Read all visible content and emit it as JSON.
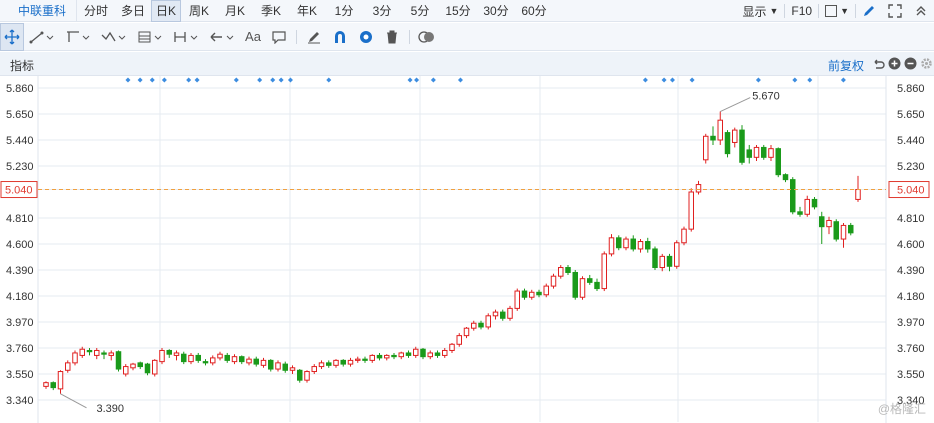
{
  "stock_name": "中联重科",
  "periods": [
    "分时",
    "多日",
    "日K",
    "周K",
    "月K",
    "季K",
    "年K",
    "1分",
    "3分",
    "5分",
    "15分",
    "30分",
    "60分"
  ],
  "active_period": "日K",
  "top_right": {
    "display_label": "显示",
    "f10_label": "F10"
  },
  "tools": [
    "move-icon",
    "line-icon",
    "channel-icon",
    "wave-icon",
    "fib-icon",
    "range-icon",
    "arrow-icon",
    "text-icon",
    "comment-icon",
    "eraser-icon",
    "magnet-icon",
    "eye-icon",
    "trash-icon",
    "toggle-icon"
  ],
  "text_tool_label": "Aa",
  "indicator_label": "指标",
  "adjust_label": "前复权",
  "y_axis_left": [
    "5.860",
    "5.650",
    "5.440",
    "5.230",
    "5.040",
    "4.810",
    "4.600",
    "4.390",
    "4.180",
    "3.970",
    "3.760",
    "3.550",
    "3.340"
  ],
  "y_axis_right": [
    "5.860",
    "5.650",
    "5.440",
    "5.230",
    "5.040",
    "4.810",
    "4.600",
    "4.390",
    "4.180",
    "3.970",
    "3.760",
    "3.550",
    "3.340"
  ],
  "current_price": "5.040",
  "high_label": "5.670",
  "low_label": "3.390",
  "watermark": "@格隆汇",
  "colors": {
    "up": "#e02020",
    "down": "#1a9a1a",
    "grid": "#e6ebf1",
    "accent": "#1a6fc9",
    "price_line": "#f0a040"
  },
  "chart_data": {
    "type": "candlestick",
    "ylim": [
      3.25,
      5.95
    ],
    "candles": [
      [
        3.45,
        3.48,
        3.43,
        3.49
      ],
      [
        3.48,
        3.44,
        3.42,
        3.49
      ],
      [
        3.43,
        3.57,
        3.39,
        3.58
      ],
      [
        3.58,
        3.64,
        3.56,
        3.66
      ],
      [
        3.64,
        3.72,
        3.62,
        3.74
      ],
      [
        3.7,
        3.75,
        3.68,
        3.77
      ],
      [
        3.74,
        3.73,
        3.7,
        3.76
      ],
      [
        3.7,
        3.74,
        3.67,
        3.76
      ],
      [
        3.72,
        3.71,
        3.67,
        3.74
      ],
      [
        3.7,
        3.72,
        3.66,
        3.74
      ],
      [
        3.73,
        3.59,
        3.57,
        3.74
      ],
      [
        3.55,
        3.61,
        3.53,
        3.63
      ],
      [
        3.6,
        3.63,
        3.58,
        3.64
      ],
      [
        3.64,
        3.61,
        3.59,
        3.65
      ],
      [
        3.63,
        3.56,
        3.54,
        3.64
      ],
      [
        3.55,
        3.66,
        3.53,
        3.67
      ],
      [
        3.65,
        3.74,
        3.63,
        3.76
      ],
      [
        3.74,
        3.71,
        3.68,
        3.75
      ],
      [
        3.7,
        3.72,
        3.66,
        3.74
      ],
      [
        3.71,
        3.65,
        3.63,
        3.73
      ],
      [
        3.65,
        3.7,
        3.63,
        3.72
      ],
      [
        3.7,
        3.66,
        3.64,
        3.72
      ],
      [
        3.65,
        3.64,
        3.62,
        3.67
      ],
      [
        3.64,
        3.68,
        3.62,
        3.7
      ],
      [
        3.68,
        3.71,
        3.66,
        3.73
      ],
      [
        3.7,
        3.66,
        3.64,
        3.72
      ],
      [
        3.65,
        3.69,
        3.63,
        3.71
      ],
      [
        3.69,
        3.65,
        3.63,
        3.7
      ],
      [
        3.64,
        3.67,
        3.62,
        3.69
      ],
      [
        3.67,
        3.63,
        3.61,
        3.69
      ],
      [
        3.62,
        3.66,
        3.6,
        3.68
      ],
      [
        3.66,
        3.59,
        3.57,
        3.67
      ],
      [
        3.59,
        3.64,
        3.57,
        3.66
      ],
      [
        3.63,
        3.58,
        3.56,
        3.65
      ],
      [
        3.58,
        3.6,
        3.55,
        3.62
      ],
      [
        3.58,
        3.5,
        3.48,
        3.59
      ],
      [
        3.5,
        3.57,
        3.48,
        3.58
      ],
      [
        3.57,
        3.61,
        3.55,
        3.63
      ],
      [
        3.61,
        3.64,
        3.59,
        3.66
      ],
      [
        3.64,
        3.62,
        3.6,
        3.66
      ],
      [
        3.62,
        3.66,
        3.6,
        3.67
      ],
      [
        3.66,
        3.63,
        3.61,
        3.67
      ],
      [
        3.63,
        3.66,
        3.61,
        3.68
      ],
      [
        3.66,
        3.67,
        3.64,
        3.69
      ],
      [
        3.67,
        3.66,
        3.64,
        3.69
      ],
      [
        3.66,
        3.7,
        3.64,
        3.71
      ],
      [
        3.7,
        3.68,
        3.66,
        3.72
      ],
      [
        3.68,
        3.7,
        3.66,
        3.71
      ],
      [
        3.7,
        3.69,
        3.67,
        3.72
      ],
      [
        3.69,
        3.72,
        3.67,
        3.73
      ],
      [
        3.72,
        3.7,
        3.68,
        3.74
      ],
      [
        3.7,
        3.75,
        3.68,
        3.77
      ],
      [
        3.75,
        3.69,
        3.67,
        3.76
      ],
      [
        3.69,
        3.72,
        3.67,
        3.74
      ],
      [
        3.72,
        3.7,
        3.68,
        3.74
      ],
      [
        3.7,
        3.74,
        3.68,
        3.76
      ],
      [
        3.74,
        3.79,
        3.72,
        3.8
      ],
      [
        3.79,
        3.86,
        3.77,
        3.88
      ],
      [
        3.86,
        3.92,
        3.84,
        3.93
      ],
      [
        3.92,
        3.96,
        3.9,
        3.98
      ],
      [
        3.96,
        3.93,
        3.91,
        3.98
      ],
      [
        3.93,
        4.02,
        3.91,
        4.04
      ],
      [
        4.02,
        4.05,
        3.99,
        4.07
      ],
      [
        4.05,
        4.0,
        3.98,
        4.07
      ],
      [
        4.0,
        4.08,
        3.98,
        4.1
      ],
      [
        4.08,
        4.22,
        4.06,
        4.24
      ],
      [
        4.22,
        4.17,
        4.15,
        4.24
      ],
      [
        4.17,
        4.21,
        4.15,
        4.23
      ],
      [
        4.21,
        4.19,
        4.17,
        4.23
      ],
      [
        4.19,
        4.26,
        4.17,
        4.28
      ],
      [
        4.26,
        4.34,
        4.24,
        4.36
      ],
      [
        4.34,
        4.41,
        4.32,
        4.43
      ],
      [
        4.41,
        4.37,
        4.35,
        4.43
      ],
      [
        4.37,
        4.17,
        4.15,
        4.39
      ],
      [
        4.17,
        4.32,
        4.15,
        4.34
      ],
      [
        4.32,
        4.29,
        4.27,
        4.35
      ],
      [
        4.29,
        4.24,
        4.22,
        4.32
      ],
      [
        4.24,
        4.52,
        4.22,
        4.54
      ],
      [
        4.52,
        4.65,
        4.5,
        4.68
      ],
      [
        4.65,
        4.57,
        4.55,
        4.67
      ],
      [
        4.57,
        4.64,
        4.55,
        4.66
      ],
      [
        4.64,
        4.56,
        4.54,
        4.67
      ],
      [
        4.56,
        4.62,
        4.53,
        4.64
      ],
      [
        4.62,
        4.56,
        4.53,
        4.65
      ],
      [
        4.56,
        4.41,
        4.39,
        4.58
      ],
      [
        4.41,
        4.5,
        4.38,
        4.52
      ],
      [
        4.5,
        4.42,
        4.38,
        4.52
      ],
      [
        4.42,
        4.61,
        4.4,
        4.63
      ],
      [
        4.61,
        4.72,
        4.59,
        4.74
      ],
      [
        4.72,
        5.02,
        4.7,
        5.05
      ],
      [
        5.02,
        5.08,
        5.0,
        5.11
      ],
      [
        5.28,
        5.47,
        5.25,
        5.49
      ],
      [
        5.47,
        5.44,
        5.4,
        5.55
      ],
      [
        5.44,
        5.6,
        5.4,
        5.67
      ],
      [
        5.5,
        5.33,
        5.3,
        5.52
      ],
      [
        5.42,
        5.52,
        5.38,
        5.54
      ],
      [
        5.52,
        5.26,
        5.24,
        5.56
      ],
      [
        5.36,
        5.3,
        5.25,
        5.4
      ],
      [
        5.3,
        5.38,
        5.27,
        5.4
      ],
      [
        5.38,
        5.3,
        5.28,
        5.4
      ],
      [
        5.3,
        5.37,
        5.27,
        5.4
      ],
      [
        5.37,
        5.16,
        5.14,
        5.38
      ],
      [
        5.16,
        5.12,
        5.1,
        5.17
      ],
      [
        5.12,
        4.86,
        4.84,
        5.14
      ],
      [
        4.86,
        4.84,
        4.82,
        4.9
      ],
      [
        4.84,
        4.96,
        4.82,
        4.99
      ],
      [
        4.96,
        4.9,
        4.88,
        4.98
      ],
      [
        4.82,
        4.74,
        4.6,
        4.86
      ],
      [
        4.74,
        4.79,
        4.68,
        4.82
      ],
      [
        4.78,
        4.64,
        4.62,
        4.8
      ],
      [
        4.64,
        4.75,
        4.57,
        4.77
      ],
      [
        4.75,
        4.69,
        4.67,
        4.77
      ],
      [
        4.96,
        5.04,
        4.94,
        5.15
      ]
    ],
    "marker_x_fractions": [
      0.137,
      0.15,
      0.163,
      0.176,
      0.202,
      0.211,
      0.253,
      0.278,
      0.292,
      0.301,
      0.311,
      0.352,
      0.439,
      0.446,
      0.464,
      0.493,
      0.691,
      0.711,
      0.72,
      0.741,
      0.812,
      0.851,
      0.867,
      0.903
    ]
  }
}
